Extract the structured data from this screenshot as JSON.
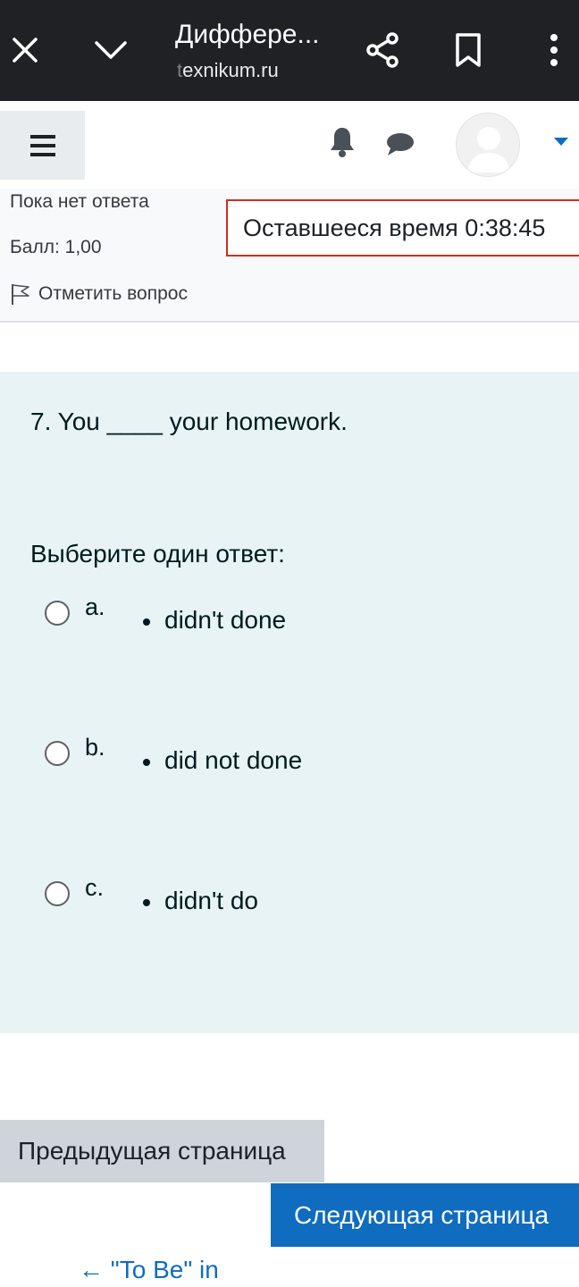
{
  "browser": {
    "title": "Диффере...",
    "url_prefix": "t",
    "url_rest": "exnikum.ru",
    "icons": [
      "close-icon",
      "chevron-down-icon",
      "share-icon",
      "bookmark-icon",
      "more-vert-icon"
    ]
  },
  "navbar": {
    "icons": [
      "hamburger-icon",
      "bell-icon",
      "chat-icon",
      "user-avatar",
      "caret-down-icon"
    ],
    "accent_color": "#0f6cbf"
  },
  "question_info": {
    "state": "Пока нет ответа",
    "grade": "Балл: 1,00",
    "flag_label": "Отметить вопрос",
    "timer": "Оставшееся время 0:38:45",
    "timer_border_color": "#ca3120"
  },
  "question": {
    "text": "7. You ____ your homework.",
    "prompt": "Выберите один ответ:",
    "options": [
      {
        "letter": "a.",
        "answer": "didn't done",
        "selected": false
      },
      {
        "letter": "b.",
        "answer": "did not done",
        "selected": false
      },
      {
        "letter": "c.",
        "answer": "didn't do",
        "selected": false
      }
    ],
    "background_color": "#e7f3f5"
  },
  "navigation": {
    "prev_label": "Предыдущая страница",
    "next_label": "Следующая страница",
    "back_link": "← \"To Be\" in"
  }
}
